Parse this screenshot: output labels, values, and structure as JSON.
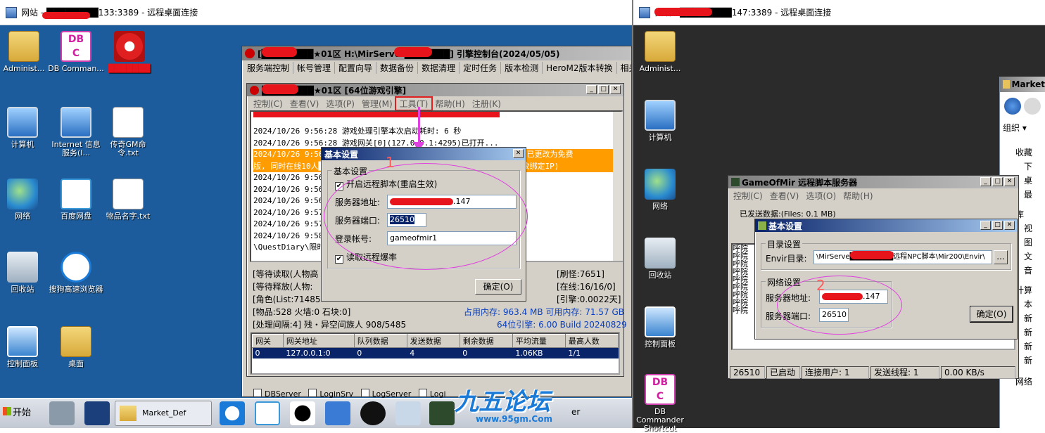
{
  "rdp_left": {
    "title": "网站 - ████████133:3389 - 远程桌面连接"
  },
  "rdp_right": {
    "title": "微端 - ████████147:3389 - 远程桌面连接"
  },
  "desktop_left_icons": [
    {
      "label": "Administ..."
    },
    {
      "label": "DB Comman..."
    },
    {
      "label": "███████"
    },
    {
      "label": "计算机"
    },
    {
      "label": "Internet 信息服务(I..."
    },
    {
      "label": "传奇GM命令.txt"
    },
    {
      "label": "网络"
    },
    {
      "label": "百度网盘"
    },
    {
      "label": "物品名字.txt"
    },
    {
      "label": "回收站"
    },
    {
      "label": "搜狗高速浏览器"
    },
    {
      "label": "控制面板"
    },
    {
      "label": "桌面"
    }
  ],
  "desktop_right_icons": [
    {
      "label": "Administ..."
    },
    {
      "label": "计算机"
    },
    {
      "label": "网络"
    },
    {
      "label": "回收站"
    },
    {
      "label": "控制面板"
    },
    {
      "label": "DB Commander Shortcut"
    }
  ],
  "engine_console": {
    "title": "[████████★01区 H:\\MirServer███████] 引擎控制台(2024/05/05)",
    "menu": [
      "服务端控制",
      "帐号管理",
      "配置向导",
      "数据备份",
      "数据清理",
      "定时任务",
      "版本检测",
      "HeroM2版本转换",
      "相关"
    ],
    "server_checks": [
      "DBServer",
      "LoginSrv",
      "LogServer",
      "Logi"
    ]
  },
  "game_engine": {
    "title": "████████★01区 [64位游戏引擎]",
    "menu": [
      "控制(C)",
      "查看(V)",
      "选项(P)",
      "管理(M)",
      "工具(T)",
      "帮助(H)",
      "注册(K)"
    ],
    "log_lines": [
      "2024/10/26 9:56:28 游戏处理引擎本次启动耗时: 6 秒",
      "2024/10/26 9:56:28 游戏网关[0](127.0.0.1:4295)已打开...",
      "2024/10/26 9:56:28 ████████████████████████████████████! 现已更改为免费",
      "版, 同时在线10人█████████████████████████████████████号密码更改绑定IP)",
      "2024/10/26 9:56:2",
      "2024/10/26 9:56:2",
      "2024/10/26 9:56:3",
      "2024/10/26 9:57:4",
      "2024/10/26 9:57:4",
      "2024/10/26 9:58:0                                        议立即清理。文件:..",
      "\\QuestDiary\\限时活"
    ],
    "stats_left": [
      "[等待读取(人物高",
      "[等待释放(人物:",
      "[角色(List:71485",
      "[物品:528 火墙:0 石块:0]",
      "[处理间隔:4]       残・异空间族人 908/5485"
    ],
    "stats_right": [
      "[刷怪:7651]",
      "[在线:16/16/0]",
      "[引擎:0.0022天]"
    ],
    "memory_line": "占用内存: 963.4 MB 可用内存: 71.57 GB",
    "build_line": "64位引擎: 6.00 Build 20240829",
    "table_headers": [
      "网关",
      "网关地址",
      "队列数据",
      "发送数据",
      "剩余数据",
      "平均流量",
      "最高人数"
    ],
    "table_row": [
      "0",
      "127.0.0.1:0",
      "0",
      "4",
      "0",
      "1.06KB",
      "1/1"
    ]
  },
  "basic_settings_left": {
    "title": "基本设置",
    "group_label": "基本设置",
    "enable_remote_script": "开启远程脚本(重启生效)",
    "server_addr_label": "服务器地址:",
    "server_addr_value": ".147",
    "server_port_label": "服务器端口:",
    "server_port_value": "26510",
    "login_label": "登录帐号:",
    "login_value": "gameofmir1",
    "read_drop_rate": "读取远程爆率",
    "ok_button": "确定(O)"
  },
  "remote_script_server": {
    "title": "GameOfMir 远程脚本服务器",
    "menu": [
      "控制(C)",
      "查看(V)",
      "选项(O)",
      "帮助(H)"
    ],
    "sent_data": "已发送数据:(Files: 0.1 MB)",
    "left_list": [
      "呼院",
      "呼院",
      "呼院",
      "呼院",
      "呼院",
      "呼院",
      "呼院",
      "呼院",
      "呼院"
    ],
    "status": [
      "26510",
      "已启动",
      "连接用户: 1",
      "发送线程: 1",
      "0.00 KB/s"
    ]
  },
  "basic_settings_right": {
    "title": "基本设置",
    "dir_group": "目录设置",
    "envir_label": "Envir目录:",
    "envir_value": "\\MirServe████████远程NPC脚本\\Mir200\\Envir\\",
    "browse": "...",
    "net_group": "网络设置",
    "server_addr_label": "服务器地址:",
    "server_addr_value": ".147",
    "server_port_label": "服务器端口:",
    "server_port_value": "26510",
    "ok_button": "确定(O)"
  },
  "explorer": {
    "title": "Market",
    "organize": "组织",
    "tree": [
      "收藏",
      "下",
      "桌",
      "最",
      "库",
      "视",
      "图",
      "文",
      "音",
      "计算",
      "本",
      "新",
      "新",
      "新",
      "新",
      "网络"
    ]
  },
  "taskbar": {
    "start": "开始",
    "market": "Market_Def",
    "server_tail": "er"
  },
  "annotations": {
    "n1": "1",
    "n2": "2"
  },
  "watermark": {
    "text": "九五论坛",
    "url": "www.95gm.Com"
  }
}
